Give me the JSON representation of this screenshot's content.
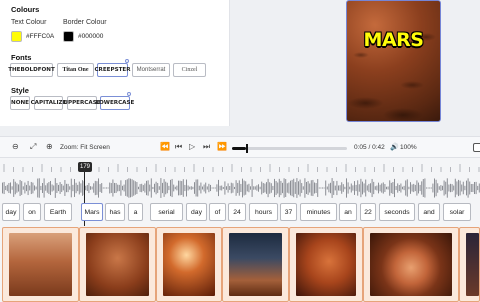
{
  "colours": {
    "title": "Colours",
    "text_colour": {
      "label": "Text Colour",
      "value": "#FFFC0A",
      "hex": "#FFFC0A"
    },
    "border_colour": {
      "label": "Border Colour",
      "value": "#000000",
      "hex": "#000000"
    }
  },
  "fonts": {
    "title": "Fonts",
    "options": [
      "THEBOLDFONT",
      "Titan One",
      "CREEPSTER",
      "Montserrat",
      "Cinzel"
    ],
    "selected": "CREEPSTER"
  },
  "style": {
    "title": "Style",
    "options": [
      "NONE",
      "CAPITALIZE",
      "UPPERCASE",
      "LOWERCASE"
    ],
    "selected": "LOWERCASE"
  },
  "preview": {
    "caption": "MARS"
  },
  "toolbar": {
    "zoom_label": "Zoom: Fit Screen",
    "time": "0:05 / 0:42",
    "volume": "100%",
    "progress_fraction": 0.12
  },
  "timeline": {
    "playhead_frame": "179",
    "words": [
      "day",
      "on",
      "Earth",
      "Mars",
      "has",
      "a",
      "serial",
      "day",
      "of",
      "24",
      "hours",
      "37",
      "minutes",
      "an",
      "22",
      "seconds",
      "and",
      "solar"
    ]
  },
  "icons": {
    "minus": "minus-icon",
    "expand": "expand-icon",
    "plus": "plus-icon",
    "rewind": "rewind-icon",
    "prev": "skip-back-icon",
    "step-back": "step-back-icon",
    "play": "play-icon",
    "step-fwd": "step-forward-icon",
    "fast-fwd": "fast-forward-icon",
    "volume": "volume-icon"
  },
  "colors": {
    "accent": "#7b8fd6",
    "thumb_border": "#e6a47a"
  }
}
